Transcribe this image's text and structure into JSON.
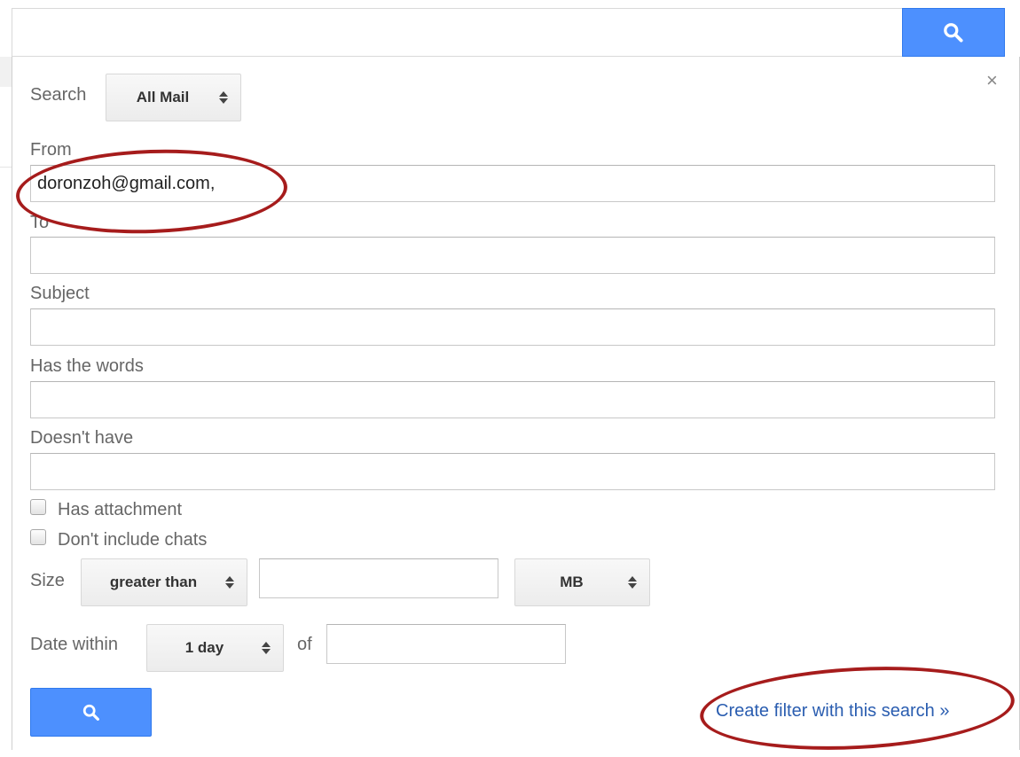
{
  "search_bar": {
    "value": "",
    "icon": "search-icon"
  },
  "panel": {
    "close_label": "×",
    "search_in": {
      "label": "Search",
      "selected": "All Mail"
    },
    "from": {
      "label": "From",
      "value": "doronzoh@gmail.com,"
    },
    "to": {
      "label": "To",
      "value": ""
    },
    "subject": {
      "label": "Subject",
      "value": ""
    },
    "has_words": {
      "label": "Has the words",
      "value": ""
    },
    "doesnt_have": {
      "label": "Doesn't have",
      "value": ""
    },
    "has_attachment": {
      "label": "Has attachment",
      "checked": false
    },
    "no_chats": {
      "label": "Don't include chats",
      "checked": false
    },
    "size": {
      "label": "Size",
      "comparator": "greater than",
      "value": "",
      "unit": "MB"
    },
    "date": {
      "label": "Date within",
      "range": "1 day",
      "of_label": "of",
      "value": ""
    },
    "create_filter": "Create filter with this search »"
  },
  "colors": {
    "accent_blue": "#4d90fe",
    "link_blue": "#2a5db0",
    "annotation_red": "#a61c1c"
  }
}
